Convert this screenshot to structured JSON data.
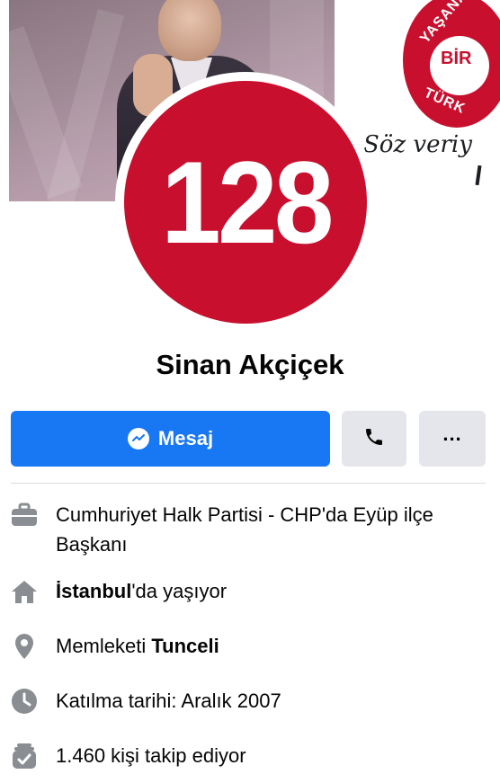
{
  "colors": {
    "brand_red": "#c8102e",
    "messenger_blue": "#1877f2",
    "button_gray": "#e4e6eb",
    "icon_gray": "#8a8d91"
  },
  "cover": {
    "logo_top_text": "YAŞANA",
    "logo_inner_text": "BİR",
    "logo_bottom_text": "TÜRK",
    "slogan": "Söz veriy"
  },
  "avatar": {
    "number": "128"
  },
  "profile": {
    "name": "Sinan Akçiçek"
  },
  "actions": {
    "message_label": "Mesaj",
    "call_icon": "phone-icon",
    "more_label": "..."
  },
  "info": {
    "work": {
      "icon": "briefcase-icon",
      "text": "Cumhuriyet Halk Partisi - CHP'da Eyüp ilçe Başkanı"
    },
    "lives": {
      "icon": "home-icon",
      "place": "İstanbul",
      "suffix": "'da yaşıyor"
    },
    "hometown": {
      "icon": "location-pin-icon",
      "prefix": "Memleketi ",
      "place": "Tunceli"
    },
    "joined": {
      "icon": "clock-icon",
      "text": "Katılma tarihi: Aralık 2007"
    },
    "followers": {
      "icon": "followers-icon",
      "text": "1.460 kişi takip ediyor"
    }
  }
}
